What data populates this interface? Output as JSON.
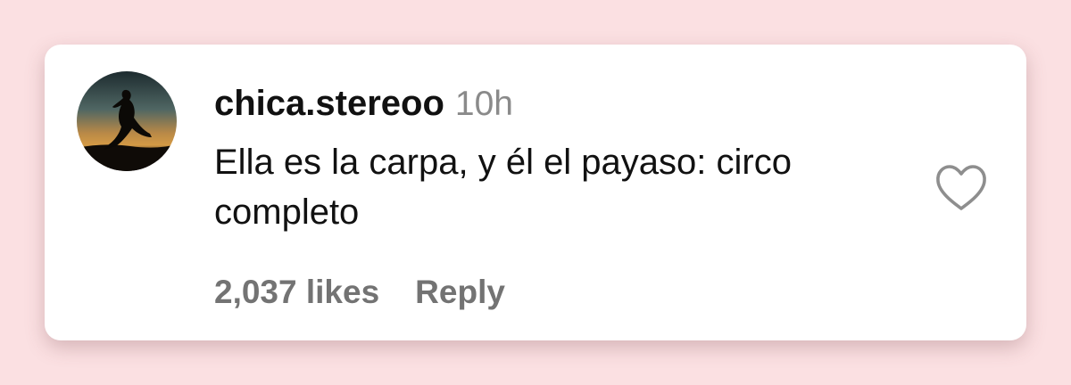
{
  "comment": {
    "username": "chica.stereoo",
    "timestamp": "10h",
    "text": "Ella es la carpa, y él el payaso: circo completo",
    "likes": "2,037 likes",
    "reply_label": "Reply",
    "like_icon": "heart-outline-icon",
    "avatar": "profile-photo-silhouette-sunset"
  },
  "colors": {
    "background": "#fbe0e2",
    "card": "#ffffff",
    "text": "#111111",
    "muted": "#737373",
    "timestamp": "#8a8a8a"
  }
}
